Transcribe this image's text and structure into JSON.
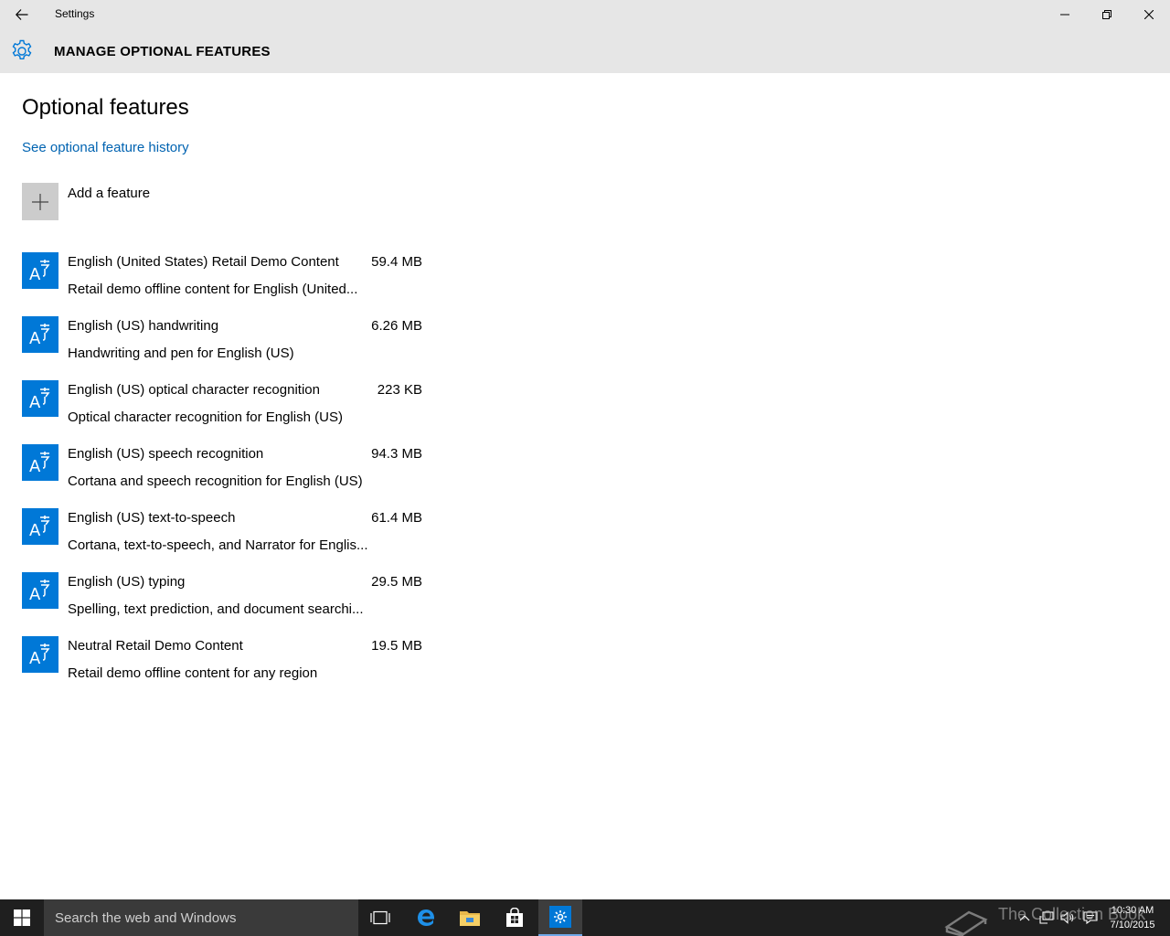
{
  "window": {
    "title": "Settings"
  },
  "header": {
    "title": "MANAGE OPTIONAL FEATURES"
  },
  "content": {
    "page_title": "Optional features",
    "history_link": "See optional feature history",
    "add_feature_label": "Add a feature"
  },
  "features": [
    {
      "name": "English (United States) Retail Demo Content",
      "description": "Retail demo offline content for English (United...",
      "size": "59.4 MB"
    },
    {
      "name": "English (US) handwriting",
      "description": "Handwriting and pen for English (US)",
      "size": "6.26 MB"
    },
    {
      "name": "English (US) optical character recognition",
      "description": "Optical character recognition for English (US)",
      "size": "223 KB"
    },
    {
      "name": "English (US) speech recognition",
      "description": "Cortana and speech recognition for English (US)",
      "size": "94.3 MB"
    },
    {
      "name": "English (US) text-to-speech",
      "description": "Cortana, text-to-speech, and Narrator for Englis...",
      "size": "61.4 MB"
    },
    {
      "name": "English (US) typing",
      "description": "Spelling, text prediction, and document searchi...",
      "size": "29.5 MB"
    },
    {
      "name": "Neutral Retail Demo Content",
      "description": "Retail demo offline content for any region",
      "size": "19.5 MB"
    }
  ],
  "taskbar": {
    "search_placeholder": "Search the web and Windows",
    "time": "10:30 AM",
    "date": "7/10/2015",
    "watermark": "The Collection Book"
  },
  "colors": {
    "accent": "#0078d7",
    "link": "#0063b1",
    "chrome": "#e6e6e6",
    "taskbar": "#1f1f1f"
  }
}
